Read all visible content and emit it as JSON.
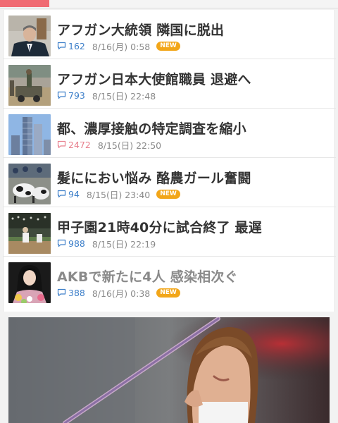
{
  "news": {
    "items": [
      {
        "title": "アフガン大統領 隣国に脱出",
        "comments": "162",
        "date": "8/16(月) 0:58",
        "badge": "NEW",
        "hot": false,
        "visited": false
      },
      {
        "title": "アフガン日本大使館職員 退避へ",
        "comments": "793",
        "date": "8/15(日) 22:48",
        "badge": "",
        "hot": false,
        "visited": false
      },
      {
        "title": "都、濃厚接触の特定調査を縮小",
        "comments": "2472",
        "date": "8/15(日) 22:50",
        "badge": "",
        "hot": true,
        "visited": false
      },
      {
        "title": "髪ににおい悩み 酪農ガール奮闘",
        "comments": "94",
        "date": "8/15(日) 23:40",
        "badge": "NEW",
        "hot": false,
        "visited": false
      },
      {
        "title": "甲子園21時40分に試合終了 最遅",
        "comments": "988",
        "date": "8/15(日) 22:19",
        "badge": "",
        "hot": false,
        "visited": false
      },
      {
        "title": "AKBで新たに4人 感染相次ぐ",
        "comments": "388",
        "date": "8/16(月) 0:38",
        "badge": "NEW",
        "hot": false,
        "visited": true
      }
    ]
  },
  "colors": {
    "accent": "#f06b73",
    "comment_count": "#3d7fc9",
    "comment_count_hot": "#e8808e",
    "new_badge": "#f2a619"
  },
  "icons": {
    "comment": "speech-bubble-icon"
  }
}
